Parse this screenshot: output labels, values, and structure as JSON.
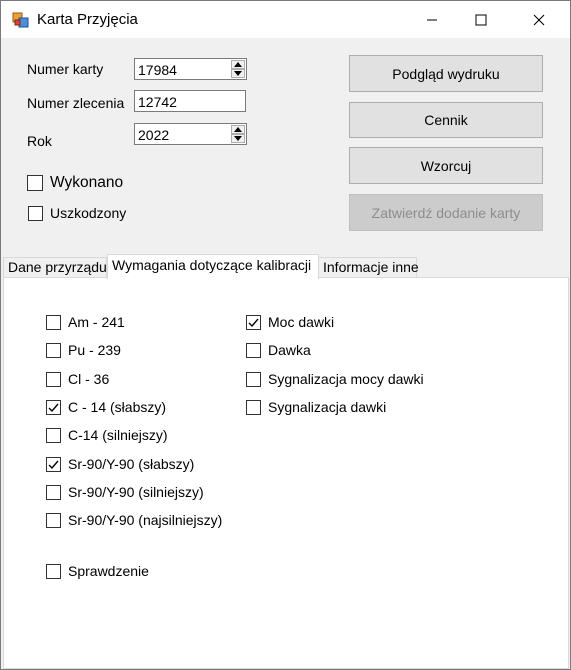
{
  "window": {
    "title": "Karta Przyjęcia"
  },
  "form": {
    "numer_karty_label": "Numer karty",
    "numer_karty_value": "17984",
    "numer_zlecenia_label": "Numer zlecenia",
    "numer_zlecenia_value": "12742",
    "rok_label": "Rok",
    "rok_value": "2022",
    "wykonano_label": "Wykonano",
    "wykonano_checked": false,
    "uszkodzony_label": "Uszkodzony",
    "uszkodzony_checked": false
  },
  "buttons": {
    "podglad": "Podgląd wydruku",
    "cennik": "Cennik",
    "wzorcuj": "Wzorcuj",
    "zatwierdz": "Zatwierdź dodanie karty"
  },
  "tabs": [
    {
      "label": "Dane przyrządu",
      "active": false
    },
    {
      "label": "Wymagania dotyczące kalibracji",
      "active": true
    },
    {
      "label": "Informacje inne",
      "active": false
    }
  ],
  "calibration": {
    "left": [
      {
        "label": "Am - 241",
        "checked": false
      },
      {
        "label": "Pu - 239",
        "checked": false
      },
      {
        "label": "Cl - 36",
        "checked": false
      },
      {
        "label": "C - 14 (słabszy)",
        "checked": true
      },
      {
        "label": "C-14 (silniejszy)",
        "checked": false
      },
      {
        "label": "Sr-90/Y-90 (słabszy)",
        "checked": true
      },
      {
        "label": "Sr-90/Y-90 (silniejszy)",
        "checked": false
      },
      {
        "label": "Sr-90/Y-90 (najsilniejszy)",
        "checked": false
      }
    ],
    "right": [
      {
        "label": "Moc dawki",
        "checked": true
      },
      {
        "label": "Dawka",
        "checked": false
      },
      {
        "label": "Sygnalizacja mocy dawki",
        "checked": false
      },
      {
        "label": "Sygnalizacja dawki",
        "checked": false
      }
    ],
    "sprawdzenie": {
      "label": "Sprawdzenie",
      "checked": false
    }
  }
}
